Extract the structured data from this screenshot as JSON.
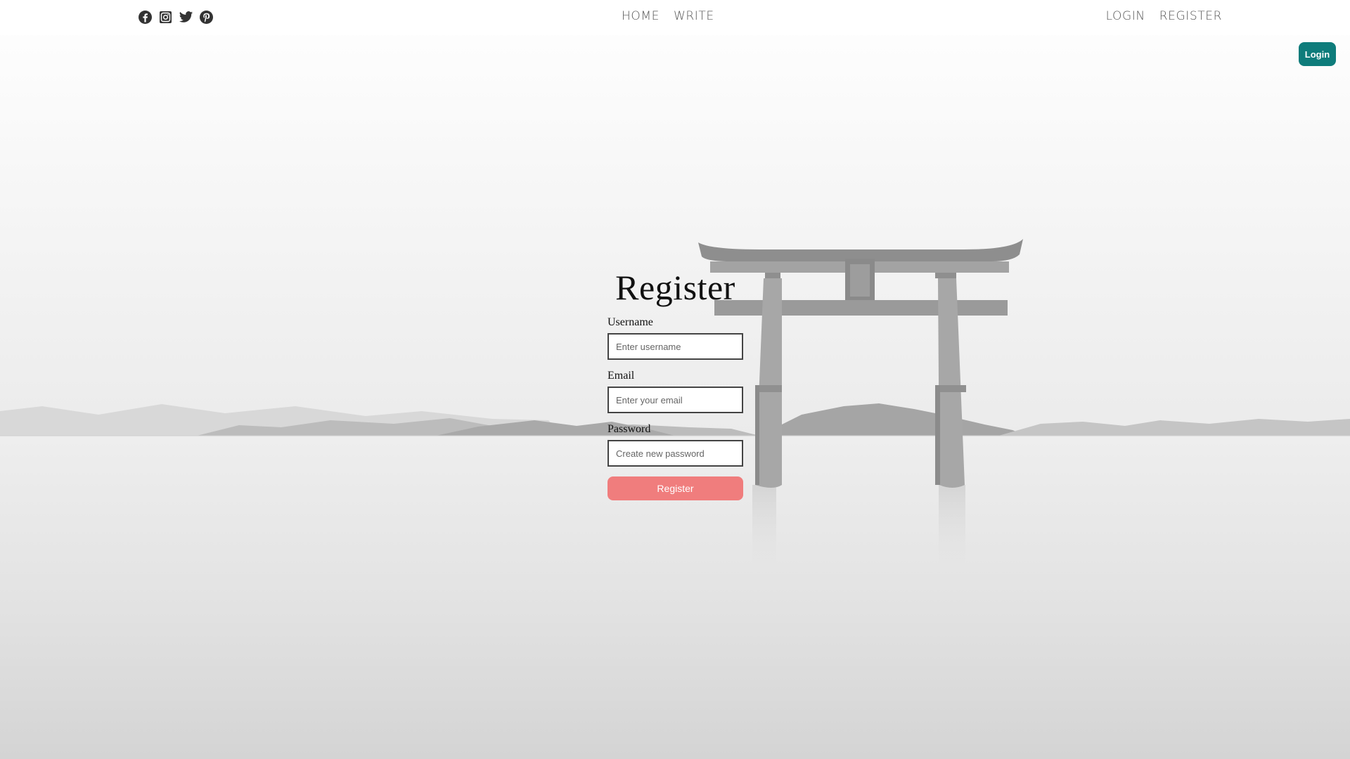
{
  "social": {
    "icons": [
      "facebook-icon",
      "instagram-icon",
      "twitter-icon",
      "pinterest-icon"
    ]
  },
  "nav": {
    "home": "HOME",
    "write": "WRITE",
    "login": "LOGIN",
    "register": "REGISTER"
  },
  "login_button": "Login",
  "form": {
    "title": "Register",
    "username_label": "Username",
    "username_placeholder": "Enter username",
    "email_label": "Email",
    "email_placeholder": "Enter your email",
    "password_label": "Password",
    "password_placeholder": "Create new password",
    "submit_label": "Register"
  },
  "colors": {
    "login_button": "#0e7c7b",
    "register_button": "#f07d7d"
  }
}
